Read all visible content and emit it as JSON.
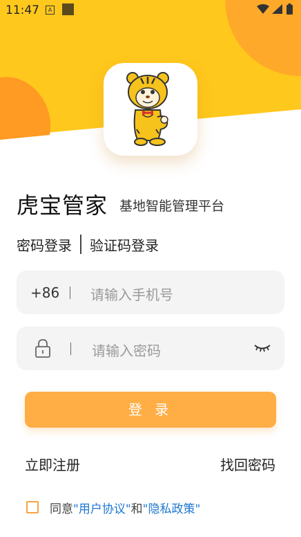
{
  "status_bar": {
    "time": "11:47",
    "notification_icon_letter": "A",
    "icons": [
      "notification-a-icon",
      "app-notification-icon",
      "wifi-icon",
      "signal-icon",
      "battery-icon"
    ]
  },
  "logo": {
    "icon": "tiger-mascot-icon"
  },
  "app": {
    "title": "虎宝管家",
    "subtitle": "基地智能管理平台"
  },
  "login_tabs": {
    "password_tab": "密码登录",
    "code_tab": "验证码登录"
  },
  "phone_field": {
    "prefix": "+86",
    "placeholder": "请输入手机号",
    "value": ""
  },
  "password_field": {
    "placeholder": "请输入密码",
    "value": "",
    "icons": [
      "lock-icon",
      "eye-closed-icon"
    ]
  },
  "login_button": "登 录",
  "links": {
    "register": "立即注册",
    "forgot_password": "找回密码"
  },
  "agreement": {
    "prefix": "同意",
    "user_agreement": "\"用户协议\"",
    "and": "和",
    "privacy_policy": "\"隐私政策\"",
    "checked": false
  },
  "colors": {
    "header_yellow": "#ffc81c",
    "accent_orange": "#ffad45",
    "checkbox_orange": "#f5a442",
    "link_blue": "#1f78d1",
    "field_bg": "#f4f4f4"
  }
}
